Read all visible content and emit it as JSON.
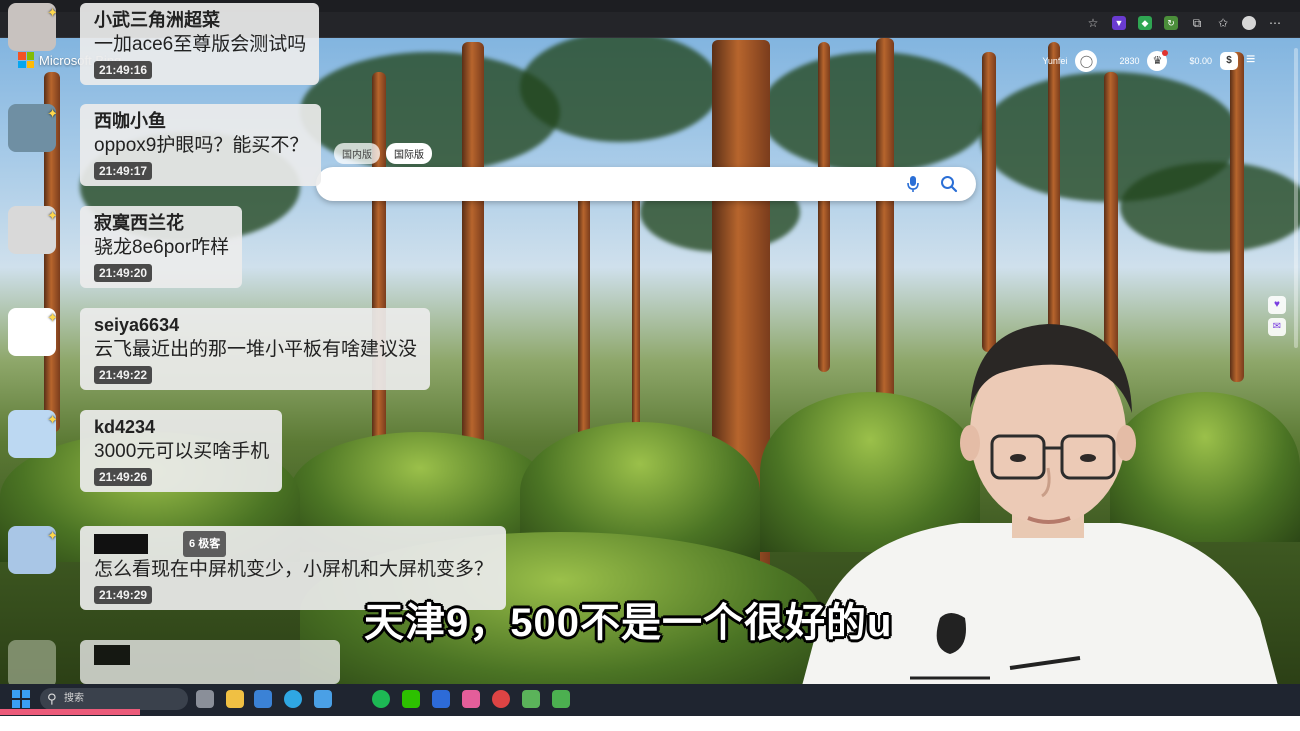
{
  "browser": {
    "toolbar_icons": [
      "star-icon",
      "ext-purple-icon",
      "ext-shield-icon",
      "ext-refresh-icon",
      "puzzle-icon",
      "favorites-icon",
      "profile-icon",
      "more-icon"
    ]
  },
  "bing": {
    "logo_text": "Microsoft Bing",
    "user_name": "Yunfei",
    "points": "2830",
    "balance": "$0.00",
    "region_tabs": [
      "国内版",
      "国际版"
    ],
    "active_region": "国际版",
    "search_placeholder": ""
  },
  "chat": [
    {
      "user": "小武三角洲超菜",
      "text": "一加ace6至尊版会测试吗",
      "time": "21:49:16",
      "avatar": "#c8c2bf"
    },
    {
      "user": "西咖小鱼",
      "text": "oppox9护眼吗？能买不？",
      "time": "21:49:17",
      "avatar": "#6f8fa3"
    },
    {
      "user": "寂寞西兰花",
      "text": "骁龙8e6por咋样",
      "time": "21:49:20",
      "avatar": "#d9d9d9"
    },
    {
      "user": "seiya6634",
      "text": "云飞最近出的那一堆小平板有啥建议没",
      "time": "21:49:22",
      "avatar": "#ffffff"
    },
    {
      "user": "kd4234",
      "text": "3000元可以买啥手机",
      "time": "21:49:26",
      "avatar": "#bcd8f2"
    },
    {
      "user": "",
      "level": "6 极客",
      "text": "怎么看现在中屏机变少，小屏机和大屏机变多？",
      "time": "21:49:29",
      "avatar": "#a9c6e6"
    }
  ],
  "subtitle": "天津9，500不是一个很好的u",
  "taskbar": {
    "search_label": "搜索"
  },
  "colors": {
    "accent_progress": "#ec5b7a",
    "chat_bubble": "#ececec",
    "taskbar": "#1f2530"
  }
}
